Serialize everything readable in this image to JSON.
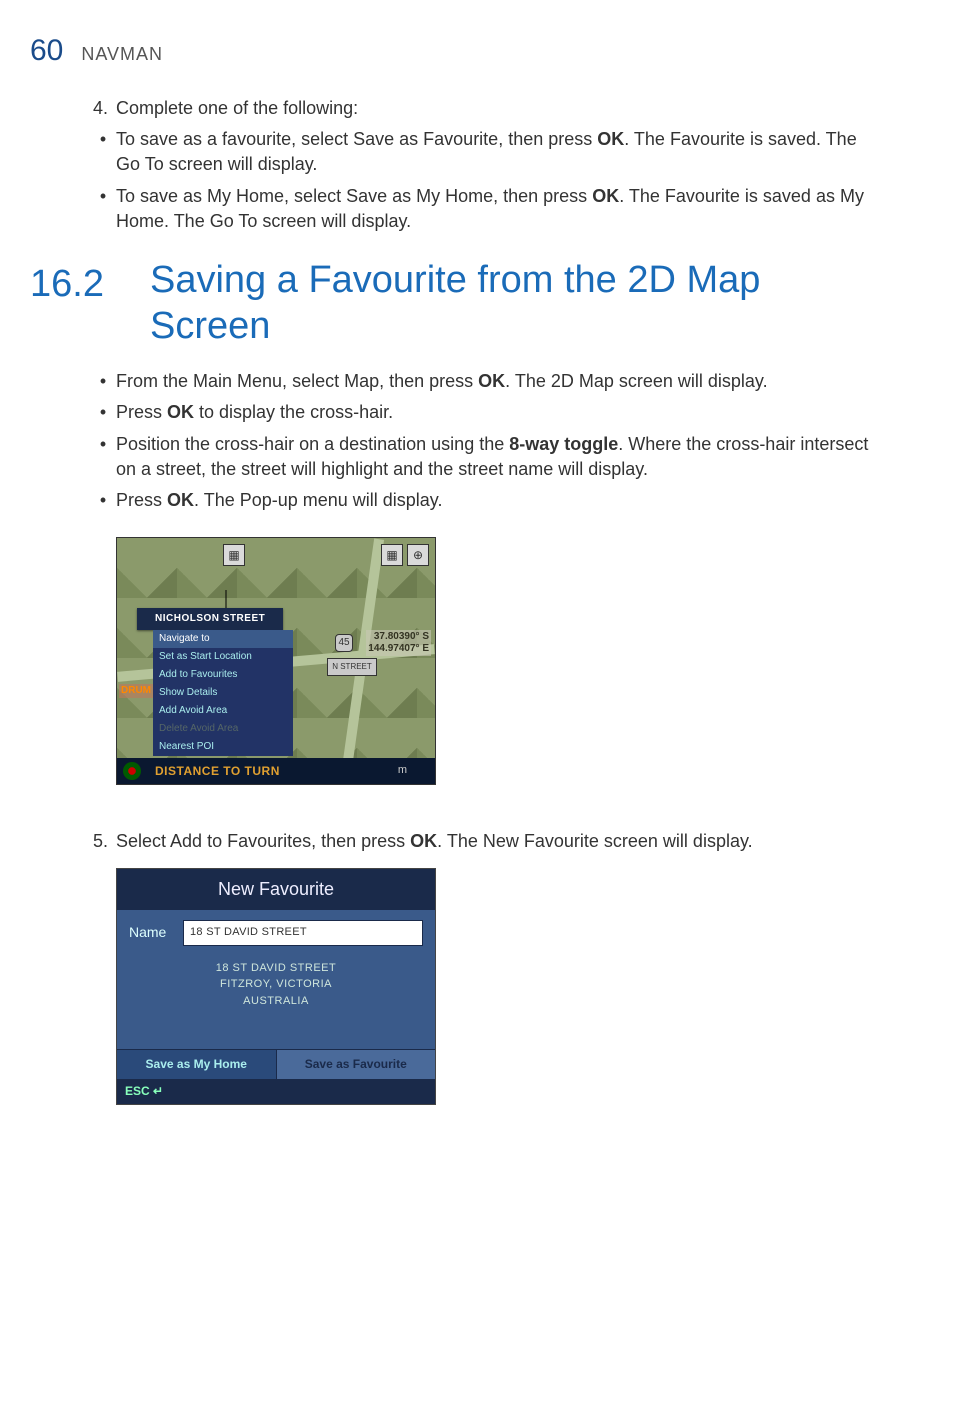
{
  "page": {
    "number": "60",
    "brand": "NAVMAN"
  },
  "step4": {
    "num": "4.",
    "text": "Complete one of the following:",
    "bullets": [
      {
        "text_a": "To save as a favourite, select Save as Favourite, then press ",
        "bold": "OK",
        "text_b": ". The Favourite is saved. The Go To screen will display."
      },
      {
        "text_a": "To save as My Home, select Save as My Home, then press ",
        "bold": "OK",
        "text_b": ". The Favourite is saved as My Home. The Go To screen will display."
      }
    ]
  },
  "section": {
    "num": "16.2",
    "title": "Saving a Favourite from the 2D Map Screen"
  },
  "section_bullets": [
    {
      "pre": "From the Main Menu, select Map, then press ",
      "bold": "OK",
      "post": ". The 2D Map screen will display."
    },
    {
      "pre": "Press ",
      "bold": "OK",
      "post": " to display the cross-hair."
    },
    {
      "pre": "Position the cross-hair on a destination using the ",
      "bold": "8-way toggle",
      "post": ". Where the cross-hair intersect on a street, the street will highlight and the street name will display."
    },
    {
      "pre": "Press ",
      "bold": "OK",
      "post": ". The Pop-up menu will display."
    }
  ],
  "map": {
    "street": "NICHOLSON STREET",
    "coords_lat": "37.80390° S",
    "coords_lon": "144.97407° E",
    "menu": [
      {
        "label": "Navigate to",
        "state": "hl"
      },
      {
        "label": "Set as Start Location",
        "state": ""
      },
      {
        "label": "Add to Favourites",
        "state": ""
      },
      {
        "label": "Show Details",
        "state": ""
      },
      {
        "label": "Add Avoid Area",
        "state": ""
      },
      {
        "label": "Delete Avoid Area",
        "state": "disabled"
      },
      {
        "label": "Nearest POI",
        "state": ""
      }
    ],
    "drum": "DRUM",
    "bottom": "DISTANCE TO TURN",
    "unit": "m",
    "speed_badge": "45",
    "street_badge": "N STREET"
  },
  "step5": {
    "num": "5.",
    "pre": "Select Add to Favourites, then press ",
    "bold": "OK",
    "post": ". The New Favourite screen will display."
  },
  "nf": {
    "title": "New Favourite",
    "name_label": "Name",
    "name_value": "18 ST DAVID STREET",
    "addr1": "18 ST DAVID STREET",
    "addr2": "FITZROY, VICTORIA",
    "addr3": "AUSTRALIA",
    "btn_left": "Save as My Home",
    "btn_right": "Save as Favourite",
    "esc": "ESC ↵"
  }
}
